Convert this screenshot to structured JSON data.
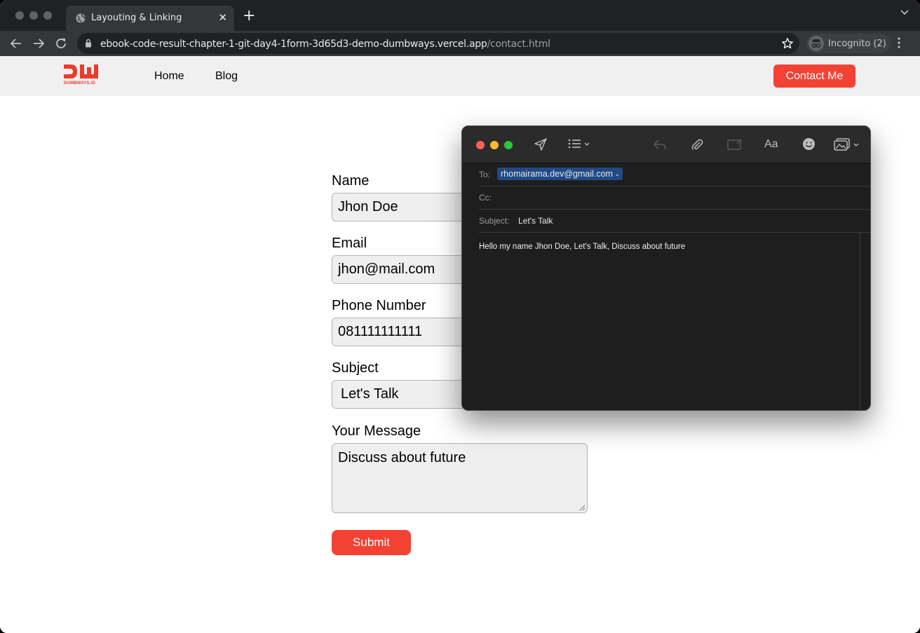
{
  "browser": {
    "tab_title": "Layouting & Linking",
    "url_host": "ebook-code-result-chapter-1-git-day4-1form-3d65d3-demo-dumbways.vercel.app",
    "url_path": "/contact.html",
    "profile_label": "Incognito (2)"
  },
  "site": {
    "logo_caption": "DUMBWAYS.ID",
    "nav": {
      "home": "Home",
      "blog": "Blog",
      "contact": "Contact Me"
    },
    "brand_color": "#f34234"
  },
  "form": {
    "name_label": "Name",
    "name_value": "Jhon Doe",
    "email_label": "Email",
    "email_value": "jhon@mail.com",
    "phone_label": "Phone Number",
    "phone_value": "081111111111",
    "subject_label": "Subject",
    "subject_value": "Let's Talk",
    "message_label": "Your Message",
    "message_value": "Discuss about future",
    "submit_label": "Submit"
  },
  "mail": {
    "to_label": "To:",
    "to_value": "rhomairama.dev@gmail.com",
    "cc_label": "Cc:",
    "subject_label": "Subject:",
    "subject_value": "Let's Talk",
    "body": "Hello my name Jhon Doe, Let's Talk, Discuss about future",
    "format_label": "Aa"
  }
}
